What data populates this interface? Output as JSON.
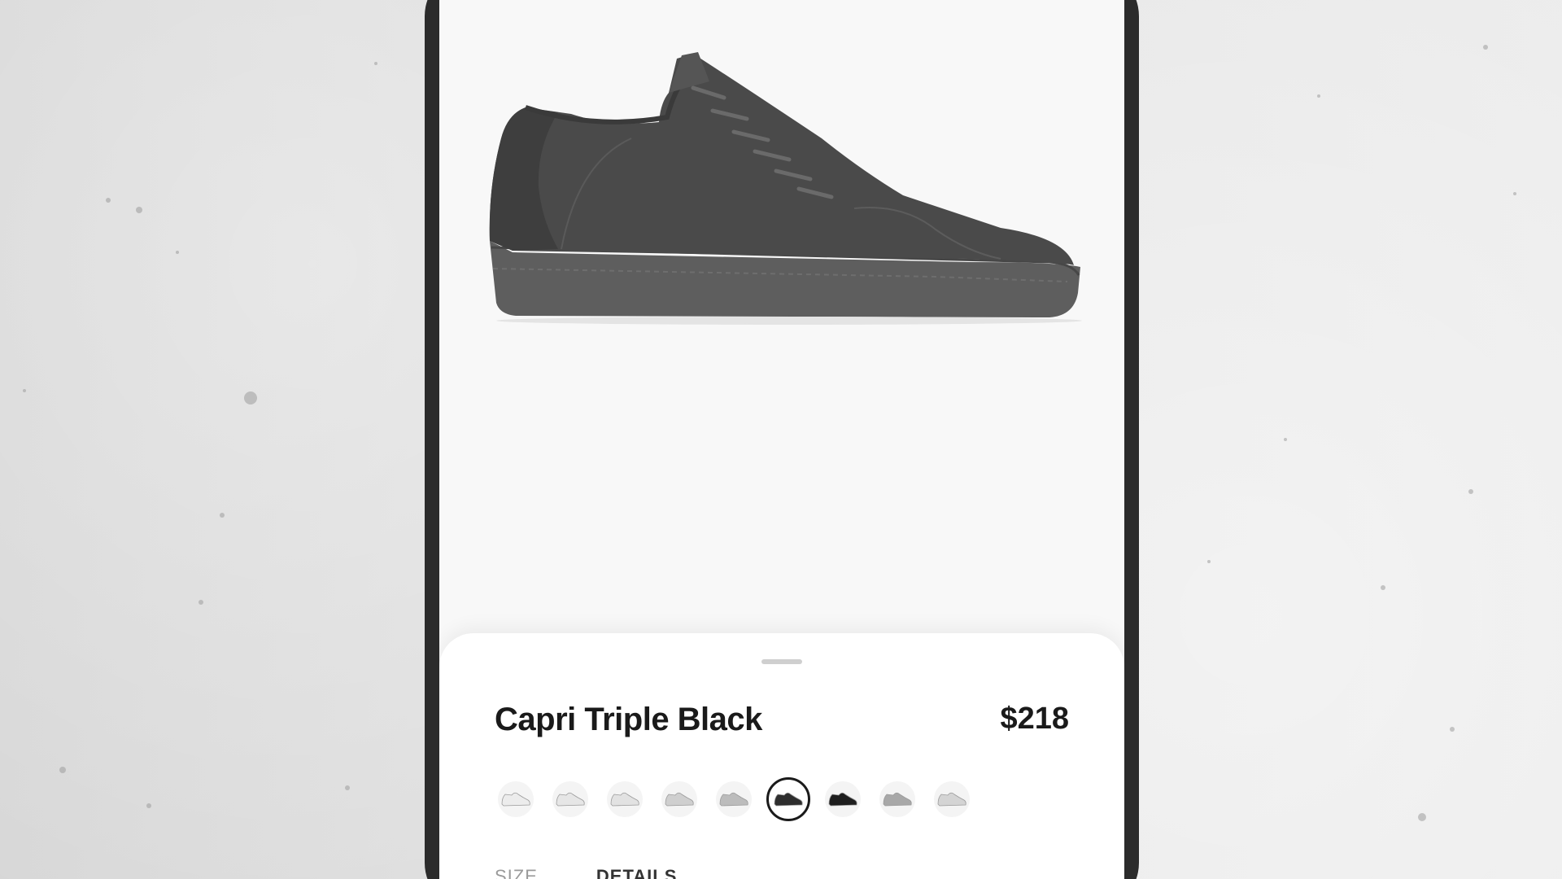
{
  "product": {
    "name": "Capri Triple Black",
    "price": "$218"
  },
  "colors": {
    "background": "#dcdcdc",
    "phone_frame": "#2b2b2b",
    "screen": "#f8f8f8",
    "sheet": "#ffffff",
    "text": "#1a1a1a"
  },
  "swatches": [
    {
      "name": "swatch-1",
      "color": "#ececec",
      "selected": false
    },
    {
      "name": "swatch-2",
      "color": "#e6e6e6",
      "selected": false
    },
    {
      "name": "swatch-3",
      "color": "#e2e2e2",
      "selected": false
    },
    {
      "name": "swatch-4",
      "color": "#cfcfcf",
      "selected": false
    },
    {
      "name": "swatch-5",
      "color": "#bcbcbc",
      "selected": false
    },
    {
      "name": "swatch-6",
      "color": "#2e2e2e",
      "selected": true
    },
    {
      "name": "swatch-7",
      "color": "#1e1e1e",
      "selected": false
    },
    {
      "name": "swatch-8",
      "color": "#a8a8a8",
      "selected": false
    },
    {
      "name": "swatch-9",
      "color": "#d4d4d4",
      "selected": false
    }
  ],
  "tabs": [
    {
      "label": "SIZE",
      "active": false
    },
    {
      "label": "DETAILS",
      "active": true
    }
  ]
}
